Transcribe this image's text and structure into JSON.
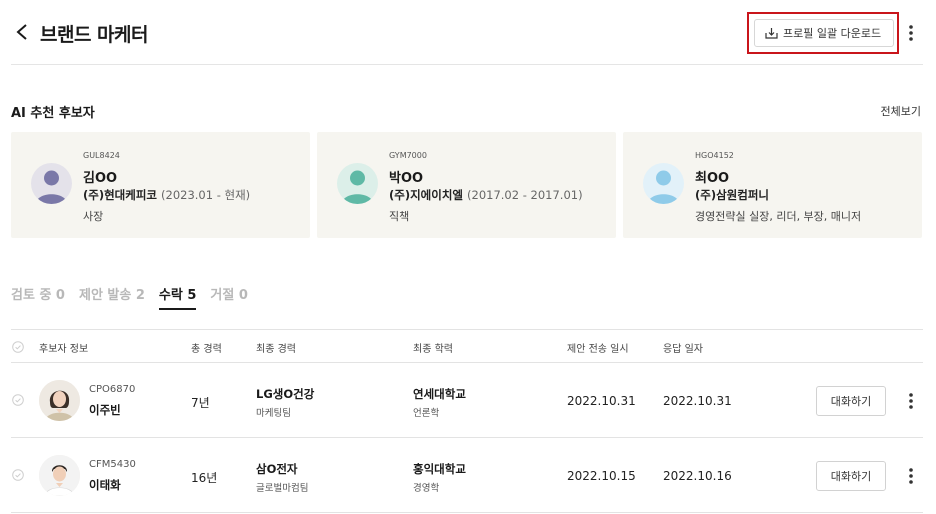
{
  "header": {
    "title": "브랜드 마케터",
    "download_label": "프로필 일괄 다운로드"
  },
  "ai_section": {
    "title": "AI 추천 후보자",
    "view_all": "전체보기",
    "cards": [
      {
        "code": "GUL8424",
        "name": "김OO",
        "company": "(주)현대케피코",
        "period": "(2023.01 - 현재)",
        "role": "사장",
        "avatar_color": "#7a78a8",
        "avatar_bg": "#e4e2ea"
      },
      {
        "code": "GYM7000",
        "name": "박OO",
        "company": "(주)지에이치엘",
        "period": "(2017.02 - 2017.01)",
        "role": "직책",
        "avatar_color": "#5fb9a6",
        "avatar_bg": "#dcefe9"
      },
      {
        "code": "HGO4152",
        "name": "최OO",
        "company": "(주)삼원컴퍼니",
        "period": "",
        "role": "경영전략실 실장, 리더, 부장, 매니저",
        "avatar_color": "#8fcbe9",
        "avatar_bg": "#e2f1f9"
      }
    ]
  },
  "tabs": [
    {
      "label": "검토 중 0",
      "active": false
    },
    {
      "label": "제안 발송 2",
      "active": false
    },
    {
      "label": "수락 5",
      "active": true
    },
    {
      "label": "거절 0",
      "active": false
    }
  ],
  "table": {
    "headers": {
      "candidate": "후보자 정보",
      "career": "총 경력",
      "last_job": "최종 경력",
      "education": "최종 학력",
      "sent_date": "제안 전송 일시",
      "reply_date": "응답 일자"
    },
    "rows": [
      {
        "code": "CPO6870",
        "name": "이주빈",
        "career": "7년",
        "company": "LG생O건강",
        "dept": "마케팅팀",
        "school": "연세대학교",
        "major": "언론학",
        "sent": "2022.10.31",
        "reply": "2022.10.31",
        "chat_label": "대화하기"
      },
      {
        "code": "CFM5430",
        "name": "이태화",
        "career": "16년",
        "company": "삼O전자",
        "dept": "글로벌마컴팀",
        "school": "홍익대학교",
        "major": "경영학",
        "sent": "2022.10.15",
        "reply": "2022.10.16",
        "chat_label": "대화하기"
      }
    ]
  },
  "colors": {
    "highlight_border": "#c9151b",
    "card_bg": "#f6f5f0",
    "active_tab": "#1a1a1a",
    "inactive_tab": "#b8b8b8"
  },
  "icons": [
    "back-arrow-icon",
    "download-icon",
    "more-vertical-icon",
    "check-circle-icon",
    "person-icon"
  ]
}
